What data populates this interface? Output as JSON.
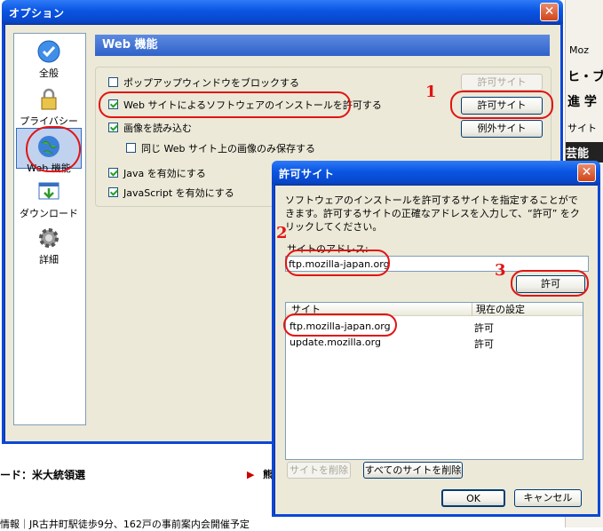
{
  "background": {
    "right_fragments": [
      "Moz",
      "ヒ・ブ",
      "進 学",
      "サイト",
      "芸能"
    ],
    "bottom_left": "ード：米大統領選",
    "bottom_mid": "▶",
    "bottom_mid2": "熊",
    "bottom_footer": "情報｜JR古井町駅徒歩9分、162戸の事前案内会開催予定"
  },
  "options_window": {
    "title": "オプション",
    "close": "✕",
    "sidebar": [
      {
        "label": "全般",
        "icon": "general-check-icon"
      },
      {
        "label": "プライバシー",
        "icon": "privacy-lock-icon"
      },
      {
        "label": "Web 機能",
        "icon": "web-features-globe-icon"
      },
      {
        "label": "ダウンロード",
        "icon": "download-icon"
      },
      {
        "label": "詳細",
        "icon": "advanced-gear-icon"
      }
    ],
    "panel_title": "Web 機能",
    "checkboxes": [
      {
        "label": "ポップアップウィンドウをブロックする",
        "checked": false
      },
      {
        "label": "Web サイトによるソフトウェアのインストールを許可する",
        "checked": true
      },
      {
        "label": "画像を読み込む",
        "checked": true
      },
      {
        "label": "同じ Web サイト上の画像のみ保存する",
        "checked": false
      },
      {
        "label": "Java を有効にする",
        "checked": true
      },
      {
        "label": "JavaScript を有効にする",
        "checked": true
      }
    ],
    "buttons": {
      "popup_allowed_sites": "許可サイト",
      "install_allowed_sites": "許可サイト",
      "image_exceptions": "例外サイト"
    }
  },
  "allowed_sites_dialog": {
    "title": "許可サイト",
    "close": "✕",
    "description": "ソフトウェアのインストールを許可するサイトを指定することができます。許可するサイトの正確なアドレスを入力して、“許可” をクリックしてください。",
    "address_label": "サイトのアドレス:",
    "address_value": "ftp.mozilla-japan.org",
    "allow_button": "許可",
    "columns": {
      "site": "サイト",
      "status": "現在の設定"
    },
    "rows": [
      {
        "site": "ftp.mozilla-japan.org",
        "status": "許可"
      },
      {
        "site": "update.mozilla.org",
        "status": "許可"
      }
    ],
    "remove_site": "サイトを削除",
    "remove_all": "すべてのサイトを削除",
    "ok": "OK",
    "cancel": "キャンセル"
  },
  "annotations": {
    "n1": "1",
    "n2": "2",
    "n3": "3"
  },
  "colors": {
    "accent": "#0b47d6",
    "highlight_red": "#e11414",
    "panel_header": "#2f62c9"
  }
}
